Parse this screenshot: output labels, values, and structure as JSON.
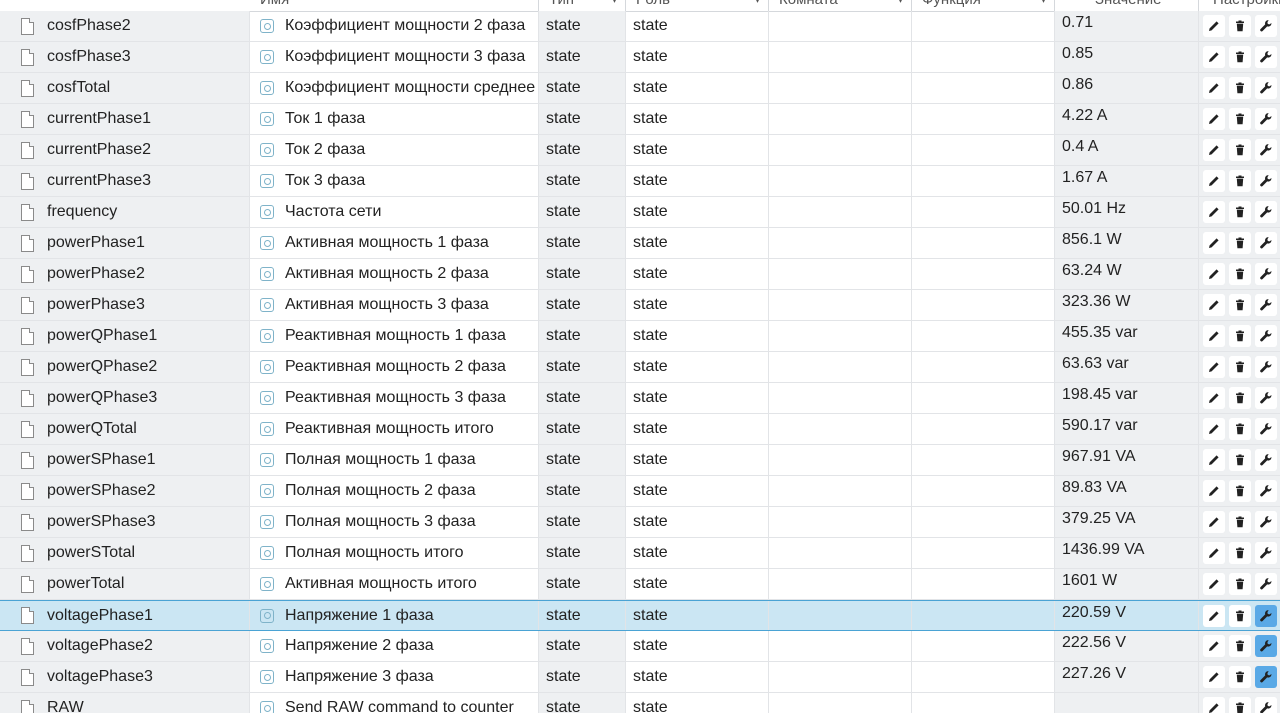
{
  "header": {
    "name": "Имя",
    "type": "Тип",
    "role": "Роль",
    "room": "Комната",
    "function": "Функция",
    "value": "Значение",
    "settings": "Настройки"
  },
  "icons": {
    "file": "file-icon",
    "state": "state-icon",
    "edit": "pencil-icon",
    "delete": "trash-icon",
    "settings": "wrench-icon"
  },
  "colors": {
    "selected_row": "#cbe6f3",
    "selected_border": "#4aa3d4",
    "active_button": "#5aa9e6"
  },
  "rows": [
    {
      "id": "cosfPhase2",
      "name": "Коэффициент мощности 2 фаза",
      "type": "state",
      "role": "state",
      "value": "0.71"
    },
    {
      "id": "cosfPhase3",
      "name": "Коэффициент мощности 3 фаза",
      "type": "state",
      "role": "state",
      "value": "0.85"
    },
    {
      "id": "cosfTotal",
      "name": "Коэффициент мощности среднее",
      "type": "state",
      "role": "state",
      "value": "0.86"
    },
    {
      "id": "currentPhase1",
      "name": "Ток 1 фаза",
      "type": "state",
      "role": "state",
      "value": "4.22 A"
    },
    {
      "id": "currentPhase2",
      "name": "Ток 2 фаза",
      "type": "state",
      "role": "state",
      "value": "0.4 A"
    },
    {
      "id": "currentPhase3",
      "name": "Ток 3 фаза",
      "type": "state",
      "role": "state",
      "value": "1.67 A"
    },
    {
      "id": "frequency",
      "name": "Частота сети",
      "type": "state",
      "role": "state",
      "value": "50.01 Hz"
    },
    {
      "id": "powerPhase1",
      "name": "Активная мощность 1 фаза",
      "type": "state",
      "role": "state",
      "value": "856.1 W"
    },
    {
      "id": "powerPhase2",
      "name": "Активная мощность 2 фаза",
      "type": "state",
      "role": "state",
      "value": "63.24 W"
    },
    {
      "id": "powerPhase3",
      "name": "Активная мощность 3 фаза",
      "type": "state",
      "role": "state",
      "value": "323.36 W"
    },
    {
      "id": "powerQPhase1",
      "name": "Реактивная мощность 1 фаза",
      "type": "state",
      "role": "state",
      "value": "455.35 var"
    },
    {
      "id": "powerQPhase2",
      "name": "Реактивная мощность 2 фаза",
      "type": "state",
      "role": "state",
      "value": "63.63 var"
    },
    {
      "id": "powerQPhase3",
      "name": "Реактивная мощность 3 фаза",
      "type": "state",
      "role": "state",
      "value": "198.45 var"
    },
    {
      "id": "powerQTotal",
      "name": "Реактивная мощность итого",
      "type": "state",
      "role": "state",
      "value": "590.17 var"
    },
    {
      "id": "powerSPhase1",
      "name": "Полная мощность 1 фаза",
      "type": "state",
      "role": "state",
      "value": "967.91 VA"
    },
    {
      "id": "powerSPhase2",
      "name": "Полная мощность 2 фаза",
      "type": "state",
      "role": "state",
      "value": "89.83 VA"
    },
    {
      "id": "powerSPhase3",
      "name": "Полная мощность 3 фаза",
      "type": "state",
      "role": "state",
      "value": "379.25 VA"
    },
    {
      "id": "powerSTotal",
      "name": "Полная мощность итого",
      "type": "state",
      "role": "state",
      "value": "1436.99 VA"
    },
    {
      "id": "powerTotal",
      "name": "Активная мощность итого",
      "type": "state",
      "role": "state",
      "value": "1601 W"
    },
    {
      "id": "voltagePhase1",
      "name": "Напряжение 1 фаза",
      "type": "state",
      "role": "state",
      "value": "220.59 V",
      "selected": true,
      "settings_active": true
    },
    {
      "id": "voltagePhase2",
      "name": "Напряжение 2 фаза",
      "type": "state",
      "role": "state",
      "value": "222.56 V",
      "settings_active": true
    },
    {
      "id": "voltagePhase3",
      "name": "Напряжение 3 фаза",
      "type": "state",
      "role": "state",
      "value": "227.26 V",
      "settings_active": true
    },
    {
      "id": "RAW",
      "name": "Send RAW command to counter",
      "type": "state",
      "role": "state",
      "value": ""
    }
  ]
}
